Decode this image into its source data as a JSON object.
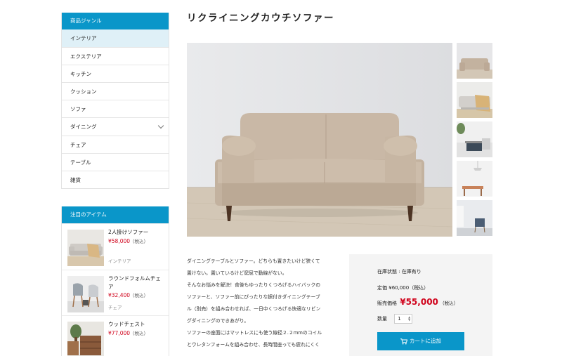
{
  "sidebar": {
    "genre_header": "商品ジャンル",
    "genres": [
      "インテリア",
      "エクステリア",
      "キッチン",
      "クッション",
      "ソファ",
      "ダイニング",
      "チェア",
      "テーブル",
      "雑貨"
    ],
    "featured_header": "注目のアイテム",
    "featured": [
      {
        "name": "2人掛けソファー",
        "price": "¥58,000",
        "tax": "（税込）",
        "category": "インテリア"
      },
      {
        "name": "ラウンドフォルムチェア",
        "price": "¥32,400",
        "tax": "（税込）",
        "category": "チェア"
      },
      {
        "name": "ウッドチェスト",
        "price": "¥77,000",
        "tax": "（税込）",
        "category": ""
      }
    ]
  },
  "product": {
    "title": "リクライニングカウチソファー",
    "description": [
      "ダイニングテーブルとソファー。どちらも置きたいけど狭くて",
      "置けない。置いているけど窮屈で動線がない。",
      "そんなお悩みを解決！食後もゆったりくつろげるハイバックの",
      "ソファーと、ソファー前にぴったりな据付きダイニングテーブ",
      "ル（別売）を組み合わせれば、一日中くつろげる快適なリビン",
      "グダイニングのできあがり。",
      "ソファーの座面にはマットレスにも使う線径２.２mmのコイル",
      "とウレタンフォームを組み合わせ、長時間座っても疲れにくく"
    ],
    "stock_status": "在庫状態 : 在庫有り",
    "list_price_label": "定価",
    "list_price": "¥60,000（税込）",
    "sale_label": "販売価格",
    "sale_price": "¥55,000",
    "sale_tax": "（税込）",
    "qty_label": "数量",
    "qty_value": "1",
    "cart_button": "カートに追加"
  },
  "colors": {
    "accent": "#0a96c9",
    "price_red": "#d0021b",
    "buybox_bg": "#f4f4f4"
  }
}
